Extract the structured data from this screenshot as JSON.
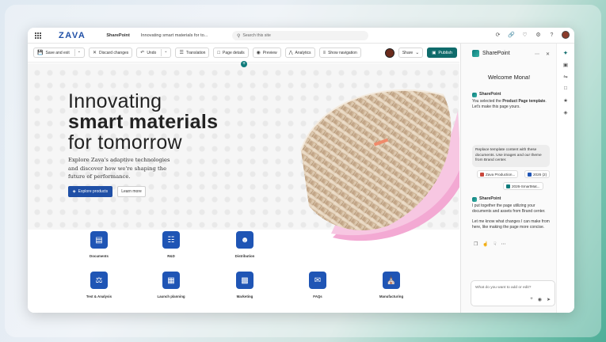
{
  "header": {
    "logo": "ZAVA",
    "site_name": "SharePoint",
    "page_name": "Innovating smart materials for to...",
    "search_placeholder": "Search this site"
  },
  "commandbar": {
    "save_exit": "Save and exit",
    "discard": "Discard changes",
    "undo": "Undo",
    "translation": "Translation",
    "page_details": "Page details",
    "preview": "Preview",
    "analytics": "Analytics",
    "show_navigation": "Show navigation",
    "share": "Share",
    "publish": "Publish"
  },
  "hero": {
    "title_line1": "Innovating",
    "title_line2": "smart materials",
    "title_line3": "for tomorrow",
    "subtitle": "Explore Zava's adaptive technologies and discover how we're shaping the future of performance.",
    "primary_button": "Explore products",
    "secondary_button": "Learn more"
  },
  "tiles": [
    {
      "label": "Documents",
      "icon": "document-icon"
    },
    {
      "label": "R&D",
      "icon": "flask-doc-icon"
    },
    {
      "label": "Distribution",
      "icon": "contact-card-icon"
    },
    {
      "label": "Test & Analysis",
      "icon": "beaker-icon"
    },
    {
      "label": "Launch planning",
      "icon": "calendar-icon"
    },
    {
      "label": "Marketing",
      "icon": "wallet-icon"
    },
    {
      "label": "FAQs",
      "icon": "chat-icon"
    },
    {
      "label": "Manufacturing",
      "icon": "factory-icon"
    }
  ],
  "panel": {
    "title": "SharePoint",
    "welcome": "Welcome Mona!",
    "msg1_sender": "SharePoint",
    "msg1_pre": "You selected the ",
    "msg1_bold": "Product Page template",
    "msg1_post": ". Let's make this page yours.",
    "bubble": "Replace template content with these documents. Use images and our theme from Brand center.",
    "chips": [
      "Zava Production...",
      "2026 (2)",
      "2026-SmartMat..."
    ],
    "msg2_sender": "SharePoint",
    "msg2_p1": "I put together the page utilizing your documents and assets from Brand center.",
    "msg2_p2": "Let me know what changes I can make from here, like making the page more concise.",
    "ask_placeholder": "What do you want to add or edit?"
  },
  "colors": {
    "brand_blue": "#1f4fa6",
    "teal": "#0f6b6b",
    "tile_blue": "#1f55b5"
  }
}
